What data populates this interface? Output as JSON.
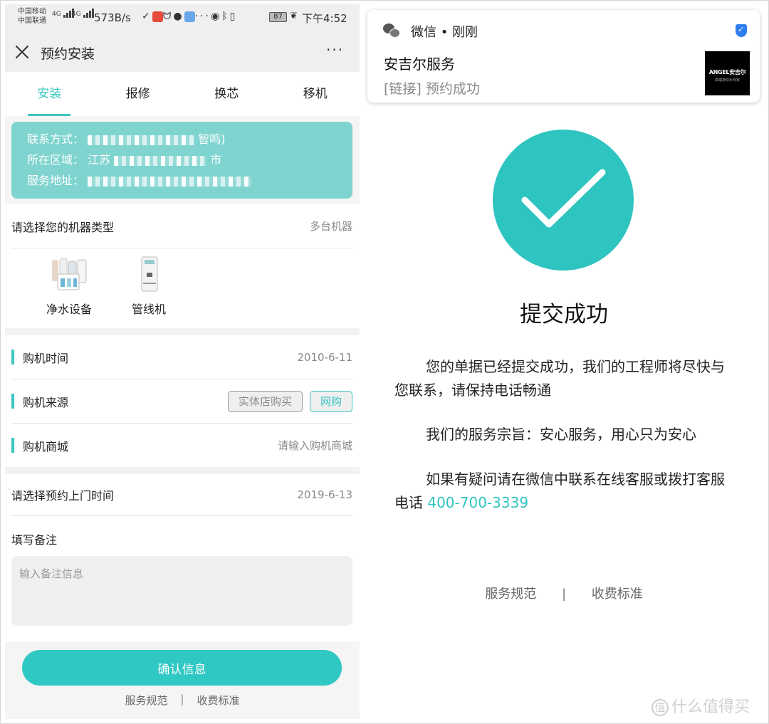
{
  "left": {
    "status": {
      "carrier1": "中国移动",
      "carrier2": "中国联通",
      "sig1": "4G",
      "sig2": "4G",
      "speed": "573B/s",
      "battery": "87",
      "time": "下午4:52"
    },
    "nav": {
      "title": "预约安装",
      "more": "···"
    },
    "tabs": [
      "安装",
      "报修",
      "换芯",
      "移机"
    ],
    "info": {
      "contact_label": "联系方式：",
      "contact_value_visible": "智鸣)",
      "region_label": "所在区域：",
      "region_value_visible": "江苏",
      "region_value_end": "市",
      "address_label": "服务地址："
    },
    "machine_type": {
      "label": "请选择您的机器类型",
      "value": "多台机器"
    },
    "machines": [
      {
        "name": "净水设备",
        "icon": "water-purifier-set-icon"
      },
      {
        "name": "管线机",
        "icon": "pipeline-dispenser-icon"
      }
    ],
    "purchase_time": {
      "label": "购机时间",
      "value": "2010-6-11"
    },
    "purchase_source": {
      "label": "购机来源",
      "options": [
        "实体店购买",
        "网购"
      ],
      "selected": "网购"
    },
    "purchase_mall": {
      "label": "购机商城",
      "placeholder": "请输入购机商城"
    },
    "visit_time": {
      "label": "请选择预约上门时间",
      "value": "2019-6-13"
    },
    "notes": {
      "label": "填写备注",
      "placeholder": "输入备注信息"
    },
    "confirm": "确认信息",
    "links": {
      "service_rules": "服务规范",
      "sep": "|",
      "fee_standard": "收费标准"
    }
  },
  "right": {
    "notification": {
      "app": "微信 • 刚刚",
      "title": "安吉尔服务",
      "body": "[链接] 预约成功",
      "logo_main": "ANGEL安吉尔",
      "logo_sub": "高端净饮水专家"
    },
    "success_title": "提交成功",
    "para1": "您的单据已经提交成功，我们的工程师将尽快与您联系，请保持电话畅通",
    "para2": "我们的服务宗旨：安心服务，用心只为安心",
    "para3_prefix": "如果有疑问请在微信中联系在线客服或拨打客服电话 ",
    "phone": "400-700-3339",
    "links": {
      "service_rules": "服务规范",
      "sep": "|",
      "fee_standard": "收费标准"
    }
  },
  "watermark": "什么值得买",
  "colors": {
    "accent": "#2ec4c0",
    "info_bg": "#7fd4cf"
  }
}
